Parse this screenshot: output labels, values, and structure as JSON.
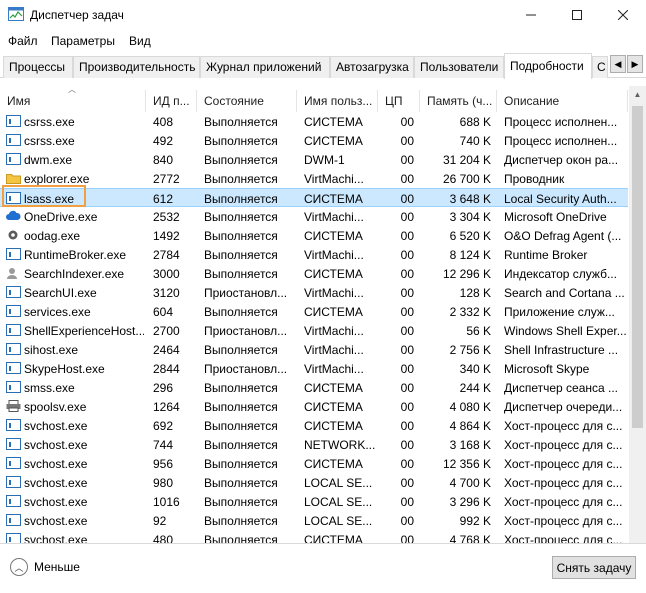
{
  "window": {
    "title": "Диспетчер задач"
  },
  "menu": [
    "Файл",
    "Параметры",
    "Вид"
  ],
  "tabs": [
    "Процессы",
    "Производительность",
    "Журнал приложений",
    "Автозагрузка",
    "Пользователи",
    "Подробности",
    "С"
  ],
  "active_tab": "Подробности",
  "columns": [
    "Имя",
    "ИД п...",
    "Состояние",
    "Имя польз...",
    "ЦП",
    "Память (ч...",
    "Описание"
  ],
  "rows": [
    {
      "name": "csrss.exe",
      "pid": "408",
      "state": "Выполняется",
      "user": "СИСТЕМА",
      "cpu": "00",
      "mem": "688 K",
      "desc": "Процесс исполнен...",
      "icon": "app-icon"
    },
    {
      "name": "csrss.exe",
      "pid": "492",
      "state": "Выполняется",
      "user": "СИСТЕМА",
      "cpu": "00",
      "mem": "740 K",
      "desc": "Процесс исполнен...",
      "icon": "app-icon"
    },
    {
      "name": "dwm.exe",
      "pid": "840",
      "state": "Выполняется",
      "user": "DWM-1",
      "cpu": "00",
      "mem": "31 204 K",
      "desc": "Диспетчер окон ра...",
      "icon": "app-icon"
    },
    {
      "name": "explorer.exe",
      "pid": "2772",
      "state": "Выполняется",
      "user": "VirtMachi...",
      "cpu": "00",
      "mem": "26 700 K",
      "desc": "Проводник",
      "icon": "folder-icon"
    },
    {
      "name": "lsass.exe",
      "pid": "612",
      "state": "Выполняется",
      "user": "СИСТЕМА",
      "cpu": "00",
      "mem": "3 648 K",
      "desc": "Local Security Auth...",
      "icon": "app-icon",
      "selected": true
    },
    {
      "name": "OneDrive.exe",
      "pid": "2532",
      "state": "Выполняется",
      "user": "VirtMachi...",
      "cpu": "00",
      "mem": "3 304 K",
      "desc": "Microsoft OneDrive",
      "icon": "cloud-icon"
    },
    {
      "name": "oodag.exe",
      "pid": "1492",
      "state": "Выполняется",
      "user": "СИСТЕМА",
      "cpu": "00",
      "mem": "6 520 K",
      "desc": "O&O Defrag Agent (...",
      "icon": "gear-icon"
    },
    {
      "name": "RuntimeBroker.exe",
      "pid": "2784",
      "state": "Выполняется",
      "user": "VirtMachi...",
      "cpu": "00",
      "mem": "8 124 K",
      "desc": "Runtime Broker",
      "icon": "app-icon"
    },
    {
      "name": "SearchIndexer.exe",
      "pid": "3000",
      "state": "Выполняется",
      "user": "СИСТЕМА",
      "cpu": "00",
      "mem": "12 296 K",
      "desc": "Индексатор служб...",
      "icon": "search-person-icon"
    },
    {
      "name": "SearchUI.exe",
      "pid": "3120",
      "state": "Приостановл...",
      "user": "VirtMachi...",
      "cpu": "00",
      "mem": "128 K",
      "desc": "Search and Cortana ...",
      "icon": "app-icon"
    },
    {
      "name": "services.exe",
      "pid": "604",
      "state": "Выполняется",
      "user": "СИСТЕМА",
      "cpu": "00",
      "mem": "2 332 K",
      "desc": "Приложение служ...",
      "icon": "app-icon"
    },
    {
      "name": "ShellExperienceHost....",
      "pid": "2700",
      "state": "Приостановл...",
      "user": "VirtMachi...",
      "cpu": "00",
      "mem": "56 K",
      "desc": "Windows Shell Exper...",
      "icon": "app-icon"
    },
    {
      "name": "sihost.exe",
      "pid": "2464",
      "state": "Выполняется",
      "user": "VirtMachi...",
      "cpu": "00",
      "mem": "2 756 K",
      "desc": "Shell Infrastructure ...",
      "icon": "app-icon"
    },
    {
      "name": "SkypeHost.exe",
      "pid": "2844",
      "state": "Приостановл...",
      "user": "VirtMachi...",
      "cpu": "00",
      "mem": "340 K",
      "desc": "Microsoft Skype",
      "icon": "app-icon"
    },
    {
      "name": "smss.exe",
      "pid": "296",
      "state": "Выполняется",
      "user": "СИСТЕМА",
      "cpu": "00",
      "mem": "244 K",
      "desc": "Диспетчер сеанса ...",
      "icon": "app-icon"
    },
    {
      "name": "spoolsv.exe",
      "pid": "1264",
      "state": "Выполняется",
      "user": "СИСТЕМА",
      "cpu": "00",
      "mem": "4 080 K",
      "desc": "Диспетчер очереди...",
      "icon": "printer-icon"
    },
    {
      "name": "svchost.exe",
      "pid": "692",
      "state": "Выполняется",
      "user": "СИСТЕМА",
      "cpu": "00",
      "mem": "4 864 K",
      "desc": "Хост-процесс для с...",
      "icon": "app-icon"
    },
    {
      "name": "svchost.exe",
      "pid": "744",
      "state": "Выполняется",
      "user": "NETWORK...",
      "cpu": "00",
      "mem": "3 168 K",
      "desc": "Хост-процесс для с...",
      "icon": "app-icon"
    },
    {
      "name": "svchost.exe",
      "pid": "956",
      "state": "Выполняется",
      "user": "СИСТЕМА",
      "cpu": "00",
      "mem": "12 356 K",
      "desc": "Хост-процесс для с...",
      "icon": "app-icon"
    },
    {
      "name": "svchost.exe",
      "pid": "980",
      "state": "Выполняется",
      "user": "LOCAL SE...",
      "cpu": "00",
      "mem": "4 700 K",
      "desc": "Хост-процесс для с...",
      "icon": "app-icon"
    },
    {
      "name": "svchost.exe",
      "pid": "1016",
      "state": "Выполняется",
      "user": "LOCAL SE...",
      "cpu": "00",
      "mem": "3 296 K",
      "desc": "Хост-процесс для с...",
      "icon": "app-icon"
    },
    {
      "name": "svchost.exe",
      "pid": "92",
      "state": "Выполняется",
      "user": "LOCAL SE...",
      "cpu": "00",
      "mem": "992 K",
      "desc": "Хост-процесс для с...",
      "icon": "app-icon"
    },
    {
      "name": "svchost.exe",
      "pid": "480",
      "state": "Выполняется",
      "user": "СИСТЕМА",
      "cpu": "00",
      "mem": "4 768 K",
      "desc": "Хост-процесс для с...",
      "icon": "app-icon"
    }
  ],
  "footer": {
    "less_label": "Меньше",
    "end_task_label": "Снять задачу"
  },
  "colors": {
    "selection": "#cce8ff",
    "highlight_outline": "#f0a040",
    "icon_blue": "#2a6db5"
  }
}
